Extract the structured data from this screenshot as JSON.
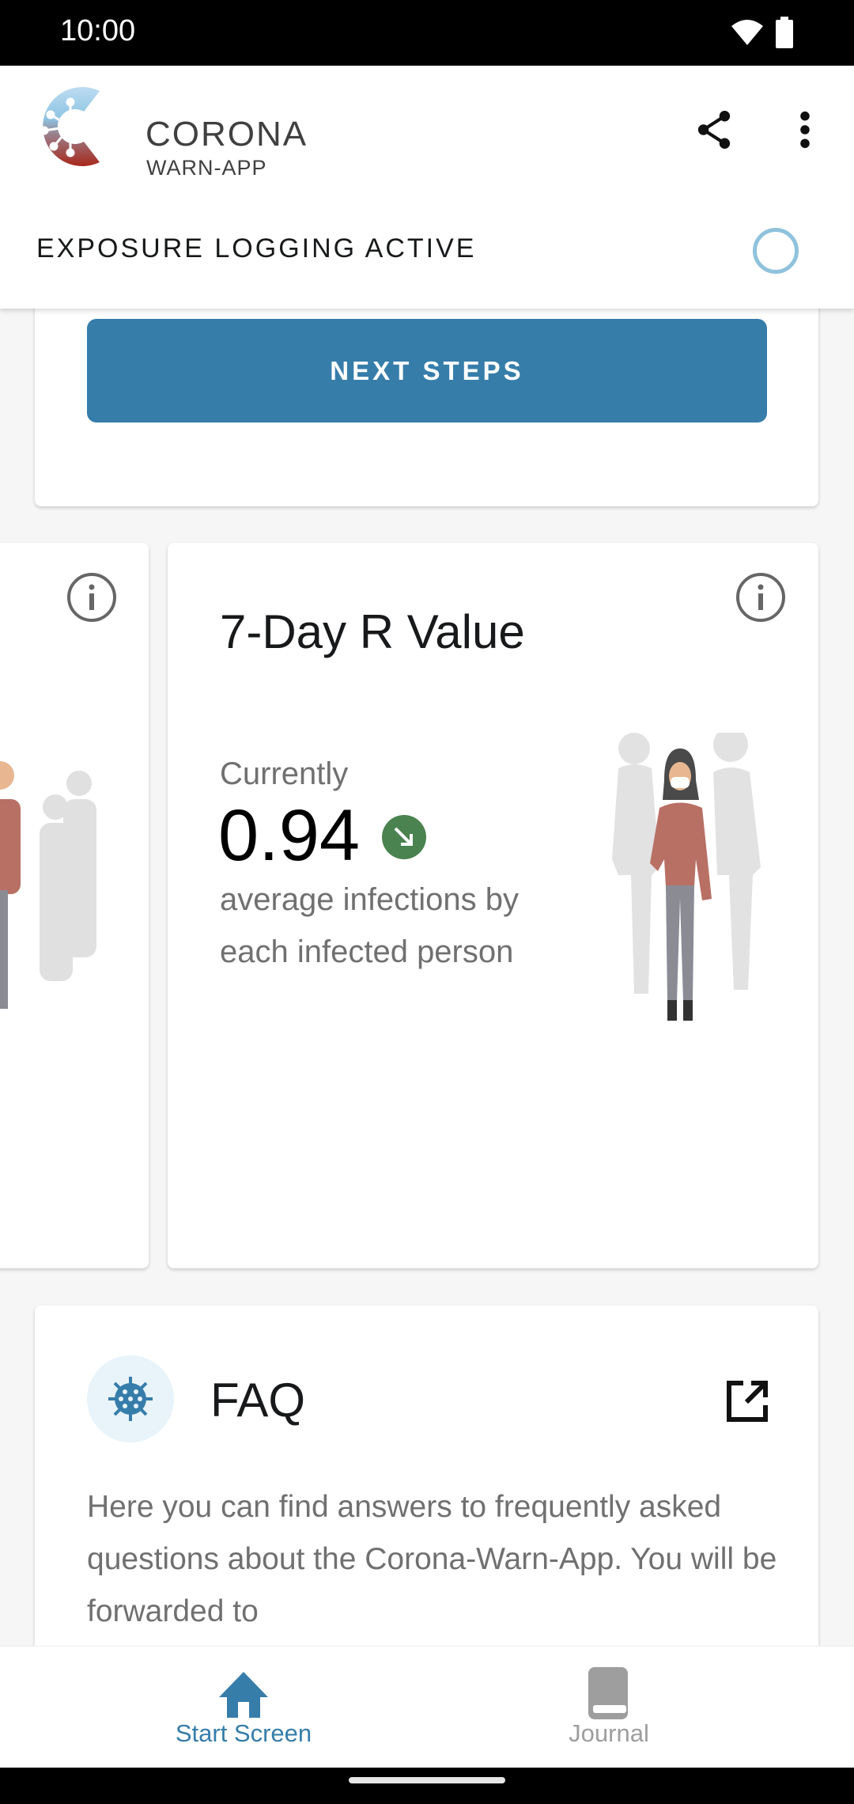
{
  "status_bar": {
    "time": "10:00",
    "icons": [
      "wifi-icon",
      "battery-icon"
    ]
  },
  "header": {
    "logo_line1": "CORONA",
    "logo_line2": "WARN-APP",
    "actions": [
      "share-icon",
      "more-vert-icon"
    ],
    "exposure_status": "EXPOSURE LOGGING ACTIVE"
  },
  "risk_card": {
    "next_steps_label": "NEXT STEPS"
  },
  "r_value_card": {
    "title": "7-Day R Value",
    "currently_label": "Currently",
    "value": "0.94",
    "trend": "down",
    "trend_color": "#4a8250",
    "description": "average infections by each infected person"
  },
  "faq_card": {
    "title": "FAQ",
    "body": "Here you can find answers to frequently asked questions about the Corona-Warn-App. You will be forwarded to"
  },
  "bottom_nav": {
    "items": [
      {
        "label": "Start Screen",
        "icon": "home-icon",
        "active": true
      },
      {
        "label": "Journal",
        "icon": "book-icon",
        "active": false
      }
    ],
    "active_color": "#367daa",
    "inactive_color": "#9e9e9e"
  }
}
